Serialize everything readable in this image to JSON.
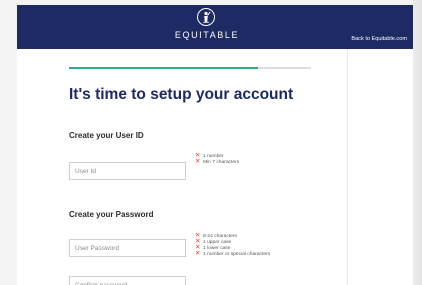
{
  "header": {
    "brand": "EQUITABLE",
    "back_link": "Back to Equitable.com"
  },
  "progress": {
    "fraction": 0.78
  },
  "page": {
    "title": "It's time to setup your account"
  },
  "user_id_section": {
    "label": "Create your User ID",
    "input_placeholder": "User Id",
    "rules": [
      "1 number",
      "Min 7 characters"
    ]
  },
  "password_section": {
    "label": "Create your Password",
    "input_placeholder": "User Password",
    "confirm_placeholder": "Confirm password",
    "rules": [
      "8-24 characters",
      "1 upper case",
      "1 lower case",
      "1 number or special characters"
    ]
  },
  "icons": {
    "logo": "equitable-logo-icon",
    "rule_status": "x-icon"
  },
  "colors": {
    "header_bg": "#1d2a63",
    "progress": "#2dae7d",
    "error": "#e04848",
    "title": "#1d2a63"
  }
}
